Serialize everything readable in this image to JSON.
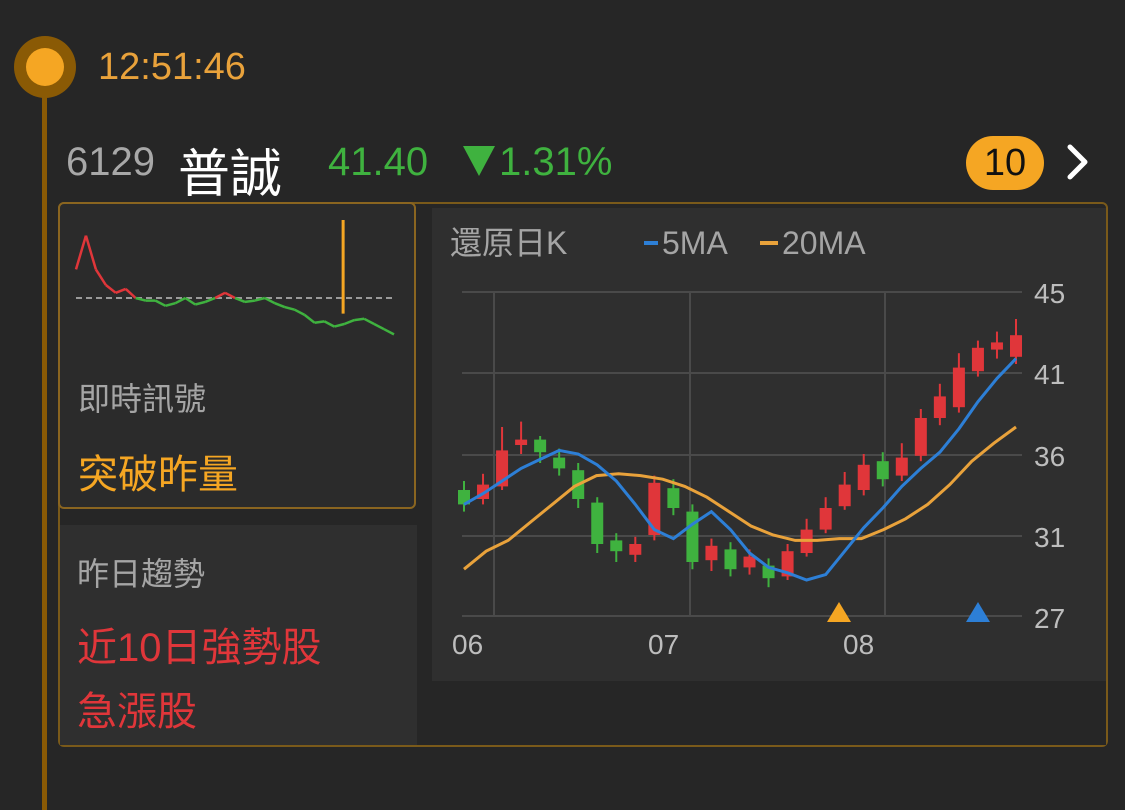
{
  "timestamp": "12:51:46",
  "stock": {
    "code": "6129",
    "name": "普誠",
    "price": "41.40",
    "change": "1.31%",
    "direction": "down",
    "up_color": "#e0363a",
    "down_color": "#3fb23f"
  },
  "badge": {
    "count": "10"
  },
  "signal": {
    "label": "即時訊號",
    "value": "突破昨量"
  },
  "trend": {
    "label": "昨日趨勢",
    "values": [
      "近10日強勢股",
      "急漲股"
    ]
  },
  "kchart": {
    "title": "還原日K",
    "legend": [
      {
        "label": "5MA",
        "color": "#2d7fd6"
      },
      {
        "label": "20MA",
        "color": "#e9a23b"
      }
    ],
    "y_ticks": [
      "45",
      "41",
      "36",
      "31",
      "27"
    ],
    "x_ticks": [
      "06",
      "07",
      "08"
    ],
    "markers": [
      {
        "shape": "triangle",
        "color": "#f5a623"
      },
      {
        "shape": "triangle",
        "color": "#2d7fd6"
      }
    ]
  },
  "chart_data": [
    {
      "type": "line",
      "chart": "intraday",
      "reference": "yesterday close (dashed)",
      "series": [
        {
          "values": [
            0.62,
            0.88,
            0.62,
            0.5,
            0.44,
            0.47,
            0.4,
            0.38,
            0.38,
            0.34,
            0.36,
            0.4,
            0.35,
            0.37,
            0.4,
            0.44,
            0.4,
            0.37,
            0.38,
            0.4,
            0.36,
            0.33,
            0.31,
            0.27,
            0.21,
            0.22,
            0.18,
            0.2,
            0.23,
            0.24,
            0.2,
            0.16,
            0.12
          ]
        }
      ],
      "volume_spike": 0.84
    },
    {
      "type": "candlestick",
      "chart": "daily",
      "ylim": [
        27,
        45
      ],
      "series": [
        {
          "name": "5MA",
          "values": [
            33.2,
            33.8,
            34.5,
            35.2,
            35.7,
            36.2,
            36.0,
            35.4,
            34.5,
            33.2,
            31.8,
            31.3,
            32.1,
            32.8,
            31.8,
            30.5,
            29.7,
            29.4,
            29.0,
            29.3,
            30.6,
            31.9,
            33.0,
            34.2,
            35.2,
            36.1,
            37.4,
            38.9,
            40.2,
            41.3
          ]
        },
        {
          "name": "20MA",
          "values": [
            29.6,
            30.6,
            31.2,
            32.2,
            33.2,
            34.2,
            34.8,
            34.9,
            34.8,
            34.6,
            34.2,
            33.6,
            32.8,
            32.0,
            31.5,
            31.2,
            31.2,
            31.3,
            31.3,
            31.8,
            32.4,
            33.2,
            34.3,
            35.6,
            36.6,
            37.5
          ]
        }
      ],
      "candles": [
        {
          "o": 34.0,
          "c": 33.2,
          "h": 34.5,
          "l": 32.8
        },
        {
          "o": 33.5,
          "c": 34.3,
          "h": 34.9,
          "l": 33.2
        },
        {
          "o": 34.2,
          "c": 36.2,
          "h": 37.5,
          "l": 34.0
        },
        {
          "o": 36.5,
          "c": 36.8,
          "h": 37.8,
          "l": 36.0
        },
        {
          "o": 36.8,
          "c": 36.1,
          "h": 37.0,
          "l": 35.5
        },
        {
          "o": 35.8,
          "c": 35.2,
          "h": 36.3,
          "l": 34.8
        },
        {
          "o": 35.1,
          "c": 33.5,
          "h": 35.5,
          "l": 33.0
        },
        {
          "o": 33.3,
          "c": 31.0,
          "h": 33.6,
          "l": 30.5
        },
        {
          "o": 31.2,
          "c": 30.6,
          "h": 31.6,
          "l": 30.0
        },
        {
          "o": 30.4,
          "c": 31.0,
          "h": 31.4,
          "l": 30.0
        },
        {
          "o": 31.5,
          "c": 34.4,
          "h": 34.8,
          "l": 31.2
        },
        {
          "o": 34.1,
          "c": 33.0,
          "h": 34.6,
          "l": 32.6
        },
        {
          "o": 32.8,
          "c": 30.0,
          "h": 33.2,
          "l": 29.6
        },
        {
          "o": 30.1,
          "c": 30.9,
          "h": 31.3,
          "l": 29.5
        },
        {
          "o": 30.7,
          "c": 29.6,
          "h": 31.1,
          "l": 29.2
        },
        {
          "o": 29.7,
          "c": 30.3,
          "h": 30.7,
          "l": 29.3
        },
        {
          "o": 29.8,
          "c": 29.1,
          "h": 30.2,
          "l": 28.6
        },
        {
          "o": 29.2,
          "c": 30.6,
          "h": 31.0,
          "l": 29.0
        },
        {
          "o": 30.5,
          "c": 31.8,
          "h": 32.4,
          "l": 30.3
        },
        {
          "o": 31.8,
          "c": 33.0,
          "h": 33.6,
          "l": 31.6
        },
        {
          "o": 33.1,
          "c": 34.3,
          "h": 35.0,
          "l": 32.9
        },
        {
          "o": 34.0,
          "c": 35.4,
          "h": 36.0,
          "l": 33.7
        },
        {
          "o": 35.6,
          "c": 34.6,
          "h": 36.1,
          "l": 34.2
        },
        {
          "o": 34.8,
          "c": 35.8,
          "h": 36.6,
          "l": 34.5
        },
        {
          "o": 35.9,
          "c": 38.0,
          "h": 38.5,
          "l": 35.6
        },
        {
          "o": 38.0,
          "c": 39.2,
          "h": 39.9,
          "l": 37.6
        },
        {
          "o": 38.6,
          "c": 40.8,
          "h": 41.6,
          "l": 38.3
        },
        {
          "o": 40.6,
          "c": 41.9,
          "h": 42.3,
          "l": 40.3
        },
        {
          "o": 41.8,
          "c": 42.2,
          "h": 42.8,
          "l": 41.3
        },
        {
          "o": 41.4,
          "c": 42.6,
          "h": 43.5,
          "l": 41.0
        }
      ]
    }
  ]
}
